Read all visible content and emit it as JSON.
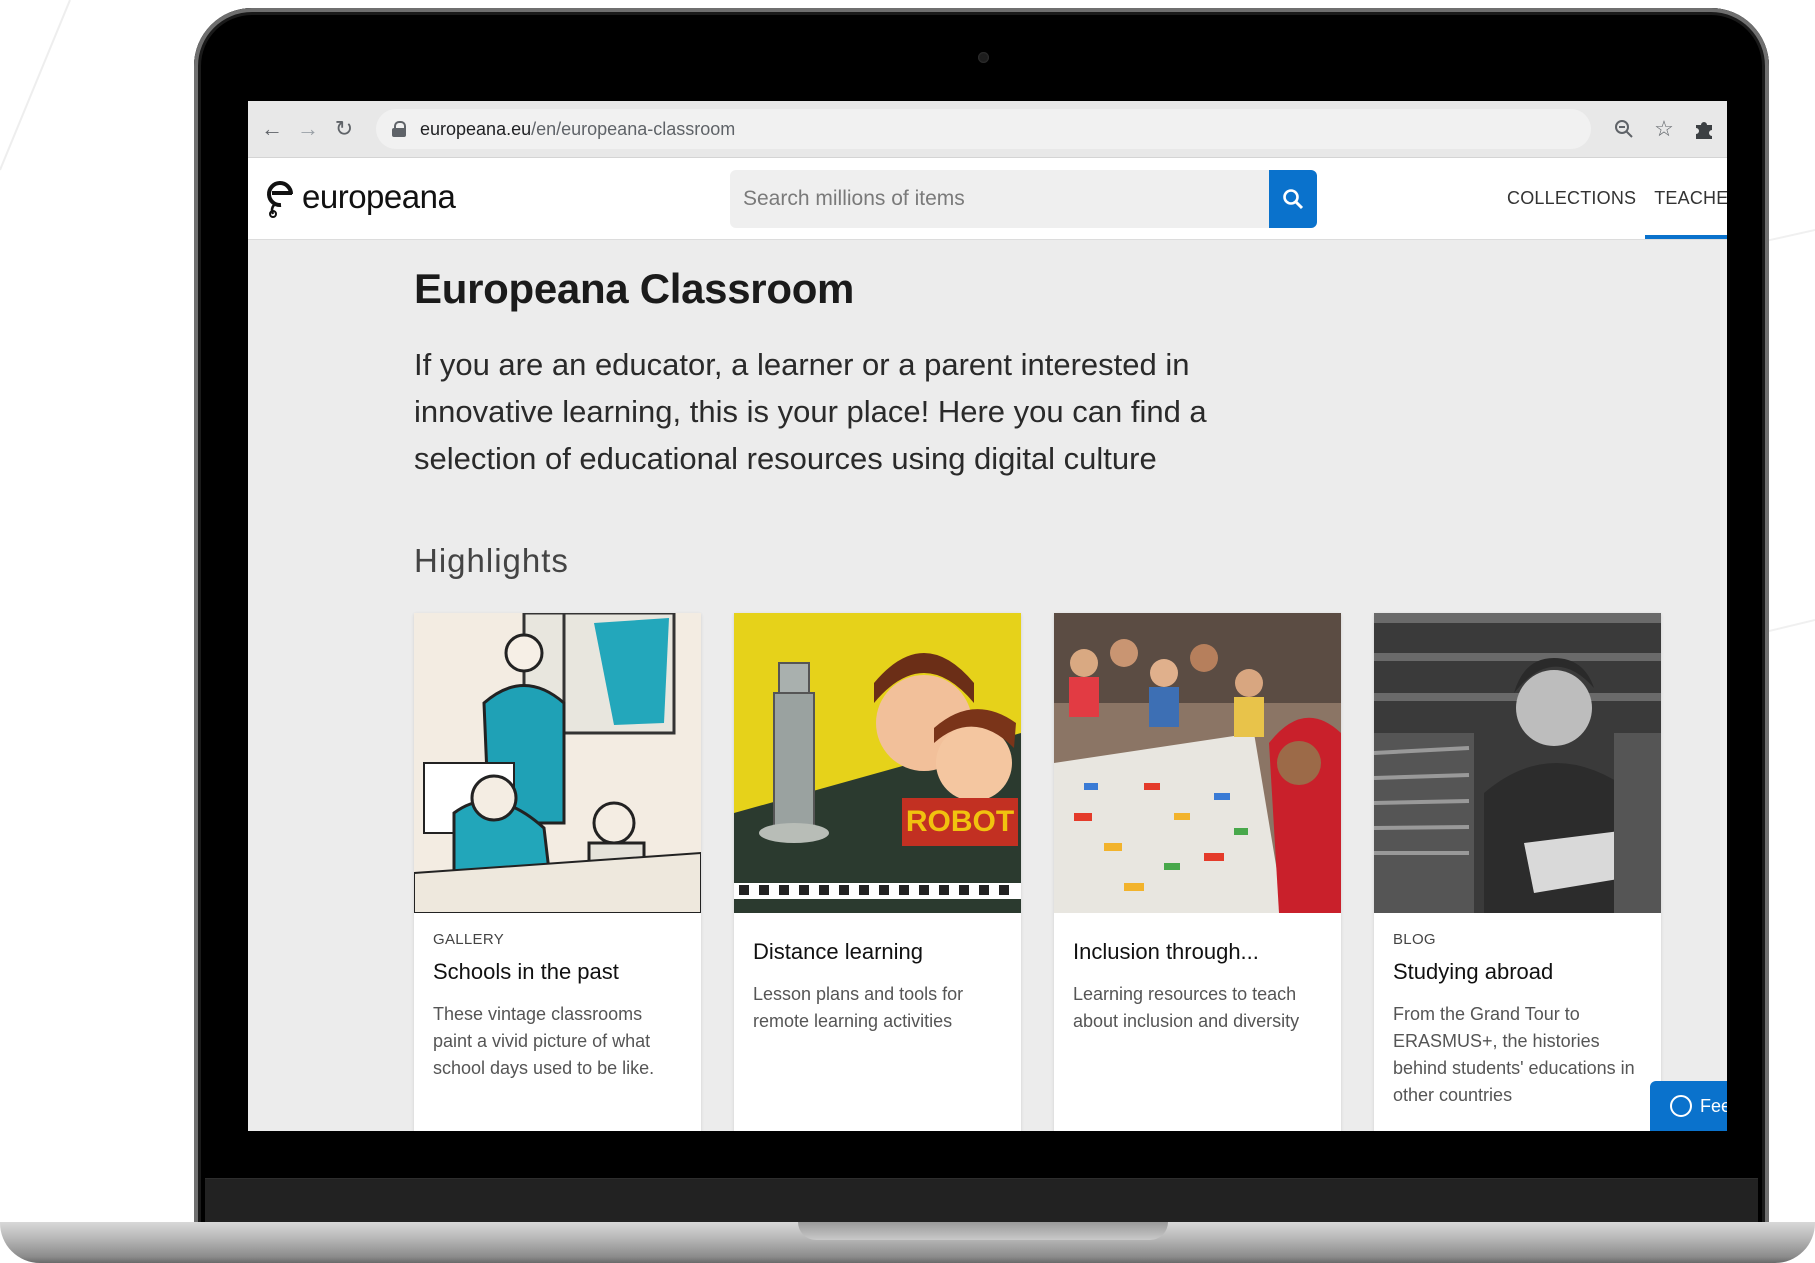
{
  "browser": {
    "url_host": "europeana.eu",
    "url_path": "/en/europeana-classroom"
  },
  "site": {
    "logo_text": "europeana",
    "search_placeholder": "Search millions of items",
    "nav": [
      {
        "label": "COLLECTIONS",
        "active": false
      },
      {
        "label": "TEACHERS",
        "active": true
      }
    ],
    "accent_color": "#0a72cc"
  },
  "page": {
    "title": "Europeana Classroom",
    "intro": "If you are an educator, a learner or a parent interested in innovative learning, this is your place! Here you can find a selection of educational resources using digital culture",
    "highlights_heading": "Highlights"
  },
  "cards": [
    {
      "type": "GALLERY",
      "title": "Schools in the past",
      "description": "These vintage classrooms paint a vivid picture of what school days used to be like.",
      "image": "vintage-classroom-illustration"
    },
    {
      "type": "",
      "title": "Distance learning",
      "description": "Lesson plans and tools for remote learning activities",
      "image": "robot-game-box",
      "image_text": "ROBOT"
    },
    {
      "type": "",
      "title": "Inclusion through...",
      "description": "Learning resources to teach about inclusion and diversity",
      "image": "children-painting-photo"
    },
    {
      "type": "BLOG",
      "title": "Studying abroad",
      "description": "From the Grand Tour to ERASMUS+, the histories behind students' educations in other countries",
      "image": "student-with-books-photo"
    }
  ],
  "feedback": {
    "label": "Fee"
  }
}
